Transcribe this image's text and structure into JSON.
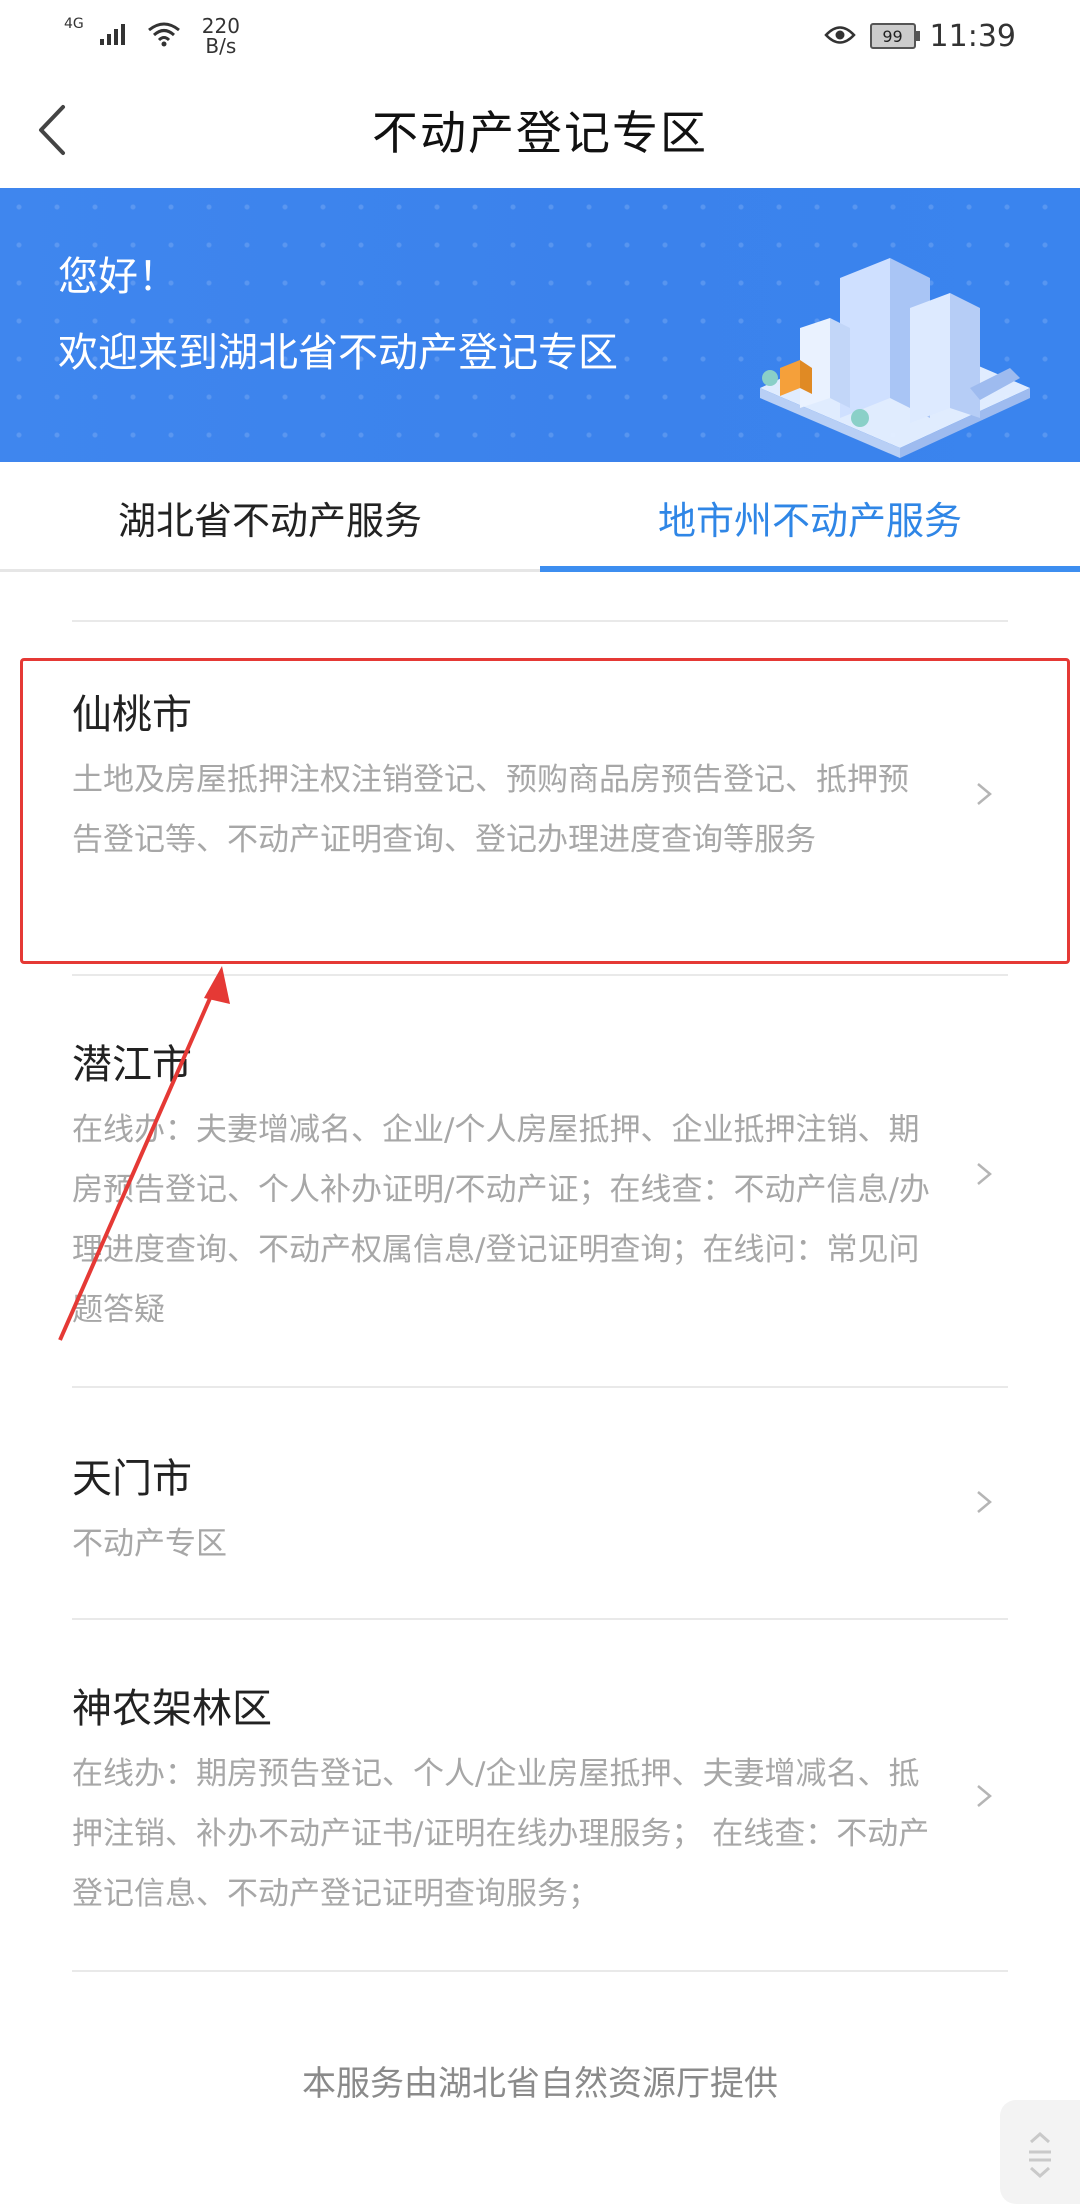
{
  "status_bar": {
    "network": "4G",
    "speed_value": "220",
    "speed_unit": "B/s",
    "battery": "99",
    "time": "11:39"
  },
  "navbar": {
    "title": "不动产登记专区"
  },
  "banner": {
    "greeting": "您好！",
    "welcome": "欢迎来到湖北省不动产登记专区"
  },
  "tabs": [
    {
      "label": "湖北省不动产服务",
      "active": false
    },
    {
      "label": "地市州不动产服务",
      "active": true
    }
  ],
  "list": [
    {
      "title": "仙桃市",
      "desc": "土地及房屋抵押注权注销登记、预购商品房预告登记、抵押预告登记等、不动产证明查询、登记办理进度查询等服务"
    },
    {
      "title": "潜江市",
      "desc": "在线办：夫妻增减名、企业/个人房屋抵押、企业抵押注销、期房预告登记、个人补办证明/不动产证；在线查：不动产信息/办理进度查询、不动产权属信息/登记证明查询；在线问：常见问题答疑"
    },
    {
      "title": "天门市",
      "desc": "不动产专区"
    },
    {
      "title": "神农架林区",
      "desc": "在线办：期房预告登记、个人/企业房屋抵押、夫妻增减名、抵押注销、补办不动产证书/证明在线办理服务； 在线查：不动产登记信息、不动产登记证明查询服务；"
    }
  ],
  "footer": {
    "text": "本服务由湖北省自然资源厅提供"
  },
  "colors": {
    "accent": "#3d8ef0",
    "banner": "#3b82ec",
    "highlight": "#e53935",
    "muted_text": "#a7a7a7"
  }
}
